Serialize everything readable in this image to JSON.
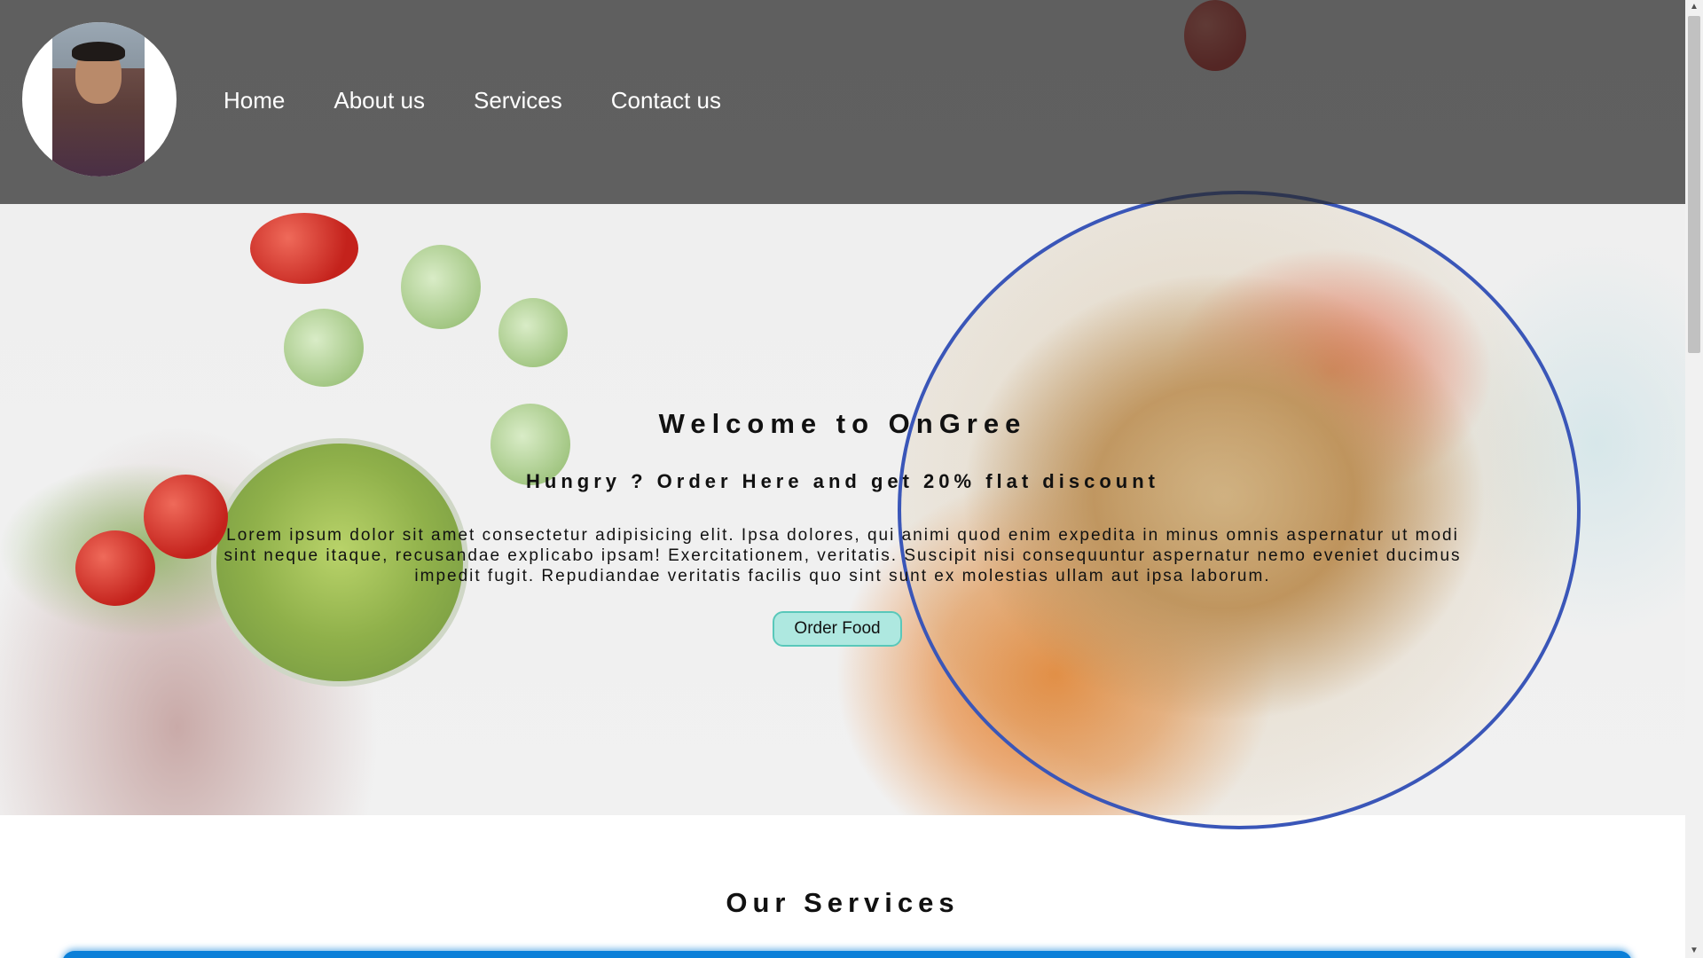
{
  "nav": {
    "items": [
      {
        "label": "Home"
      },
      {
        "label": "About us"
      },
      {
        "label": "Services"
      },
      {
        "label": "Contact us"
      }
    ]
  },
  "hero": {
    "title": "Welcome to OnGree",
    "subtitle": "Hungry ? Order Here and get 20% flat discount",
    "text": "Lorem ipsum dolor sit amet consectetur adipisicing elit. Ipsa dolores, qui animi quod enim expedita in minus omnis aspernatur ut modi sint neque itaque, recusandae explicabo ipsam! Exercitationem, veritatis. Suscipit nisi consequuntur aspernatur nemo eveniet ducimus impedit fugit. Repudiandae veritatis facilis quo sint sunt ex molestias ullam aut ipsa laborum.",
    "button_label": "Order Food"
  },
  "services": {
    "title": "Our Services"
  },
  "colors": {
    "header_overlay": "#282828",
    "button_bg": "#aee8e0",
    "button_border": "#59c8ba",
    "services_bar": "#0a7fd8"
  },
  "scrollbar": {
    "up_icon": "▲",
    "down_icon": "▼"
  }
}
